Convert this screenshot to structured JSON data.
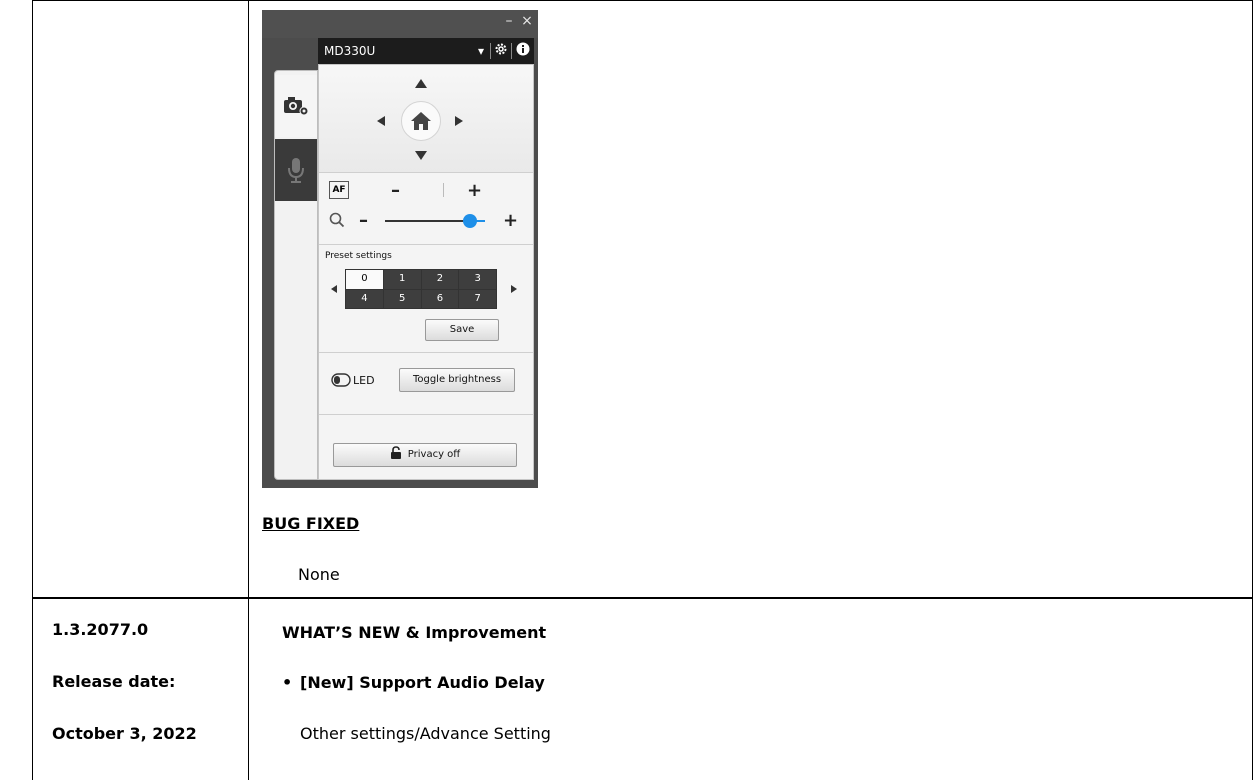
{
  "camera_app": {
    "window": {
      "minimize": "–",
      "close": "×"
    },
    "titlebar": {
      "model": "MD330U",
      "dropdown_icon": "caret-down-icon",
      "settings_icon": "gear-icon",
      "info_icon": "info-icon"
    },
    "sidebar": [
      {
        "name": "camera-settings-tab",
        "icon": "camera-gear-icon",
        "active": true
      },
      {
        "name": "microphone-tab",
        "icon": "microphone-icon",
        "active": false
      }
    ],
    "ptz": {
      "home_icon": "home-icon"
    },
    "focus": {
      "af_label": "AF",
      "minus": "–",
      "plus": "+"
    },
    "zoom": {
      "icon": "magnifier-icon",
      "minus": "–",
      "plus": "+",
      "level": 0.85,
      "accent": "#1e8fe8"
    },
    "preset": {
      "label": "Preset settings",
      "cells": [
        "0",
        "1",
        "2",
        "3",
        "4",
        "5",
        "6",
        "7"
      ],
      "selected": "0",
      "save_label": "Save"
    },
    "led": {
      "label": "LED",
      "toggle_label": "Toggle brightness"
    },
    "privacy": {
      "label": "Privacy off",
      "icon": "unlock-icon"
    }
  },
  "doc": {
    "bug_fixed_heading": "BUG FIXED",
    "bug_fixed_value": "None",
    "version": "1.3.2077.0",
    "release_date_label": "Release date:",
    "release_date": "October 3, 2022",
    "whats_new_heading": "WHAT’S NEW & Improvement",
    "bullet": "•",
    "new_item": "[New] Support Audio Delay",
    "setting_path": "Other settings/Advance Setting"
  }
}
